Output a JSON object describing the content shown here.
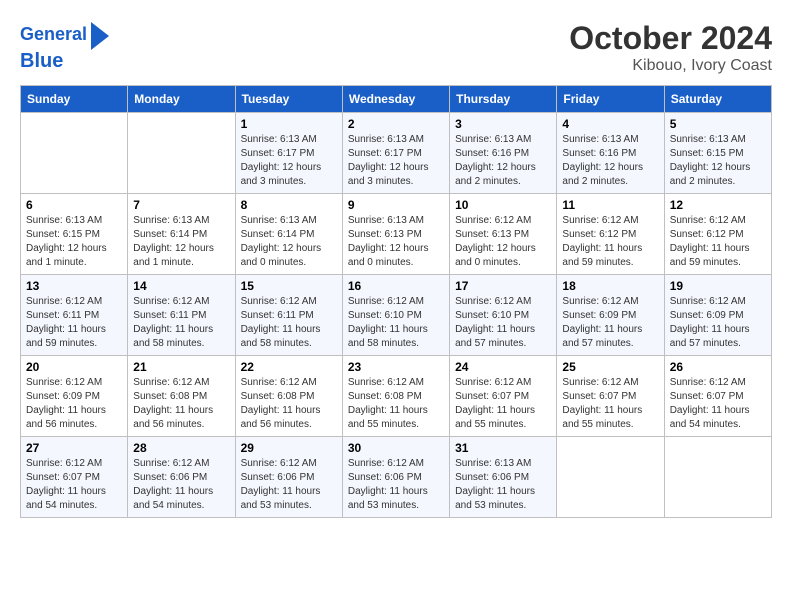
{
  "logo": {
    "line1": "General",
    "line2": "Blue"
  },
  "title": "October 2024",
  "subtitle": "Kibouo, Ivory Coast",
  "days_of_week": [
    "Sunday",
    "Monday",
    "Tuesday",
    "Wednesday",
    "Thursday",
    "Friday",
    "Saturday"
  ],
  "weeks": [
    [
      {
        "day": "",
        "info": ""
      },
      {
        "day": "",
        "info": ""
      },
      {
        "day": "1",
        "info": "Sunrise: 6:13 AM\nSunset: 6:17 PM\nDaylight: 12 hours and 3 minutes."
      },
      {
        "day": "2",
        "info": "Sunrise: 6:13 AM\nSunset: 6:17 PM\nDaylight: 12 hours and 3 minutes."
      },
      {
        "day": "3",
        "info": "Sunrise: 6:13 AM\nSunset: 6:16 PM\nDaylight: 12 hours and 2 minutes."
      },
      {
        "day": "4",
        "info": "Sunrise: 6:13 AM\nSunset: 6:16 PM\nDaylight: 12 hours and 2 minutes."
      },
      {
        "day": "5",
        "info": "Sunrise: 6:13 AM\nSunset: 6:15 PM\nDaylight: 12 hours and 2 minutes."
      }
    ],
    [
      {
        "day": "6",
        "info": "Sunrise: 6:13 AM\nSunset: 6:15 PM\nDaylight: 12 hours and 1 minute."
      },
      {
        "day": "7",
        "info": "Sunrise: 6:13 AM\nSunset: 6:14 PM\nDaylight: 12 hours and 1 minute."
      },
      {
        "day": "8",
        "info": "Sunrise: 6:13 AM\nSunset: 6:14 PM\nDaylight: 12 hours and 0 minutes."
      },
      {
        "day": "9",
        "info": "Sunrise: 6:13 AM\nSunset: 6:13 PM\nDaylight: 12 hours and 0 minutes."
      },
      {
        "day": "10",
        "info": "Sunrise: 6:12 AM\nSunset: 6:13 PM\nDaylight: 12 hours and 0 minutes."
      },
      {
        "day": "11",
        "info": "Sunrise: 6:12 AM\nSunset: 6:12 PM\nDaylight: 11 hours and 59 minutes."
      },
      {
        "day": "12",
        "info": "Sunrise: 6:12 AM\nSunset: 6:12 PM\nDaylight: 11 hours and 59 minutes."
      }
    ],
    [
      {
        "day": "13",
        "info": "Sunrise: 6:12 AM\nSunset: 6:11 PM\nDaylight: 11 hours and 59 minutes."
      },
      {
        "day": "14",
        "info": "Sunrise: 6:12 AM\nSunset: 6:11 PM\nDaylight: 11 hours and 58 minutes."
      },
      {
        "day": "15",
        "info": "Sunrise: 6:12 AM\nSunset: 6:11 PM\nDaylight: 11 hours and 58 minutes."
      },
      {
        "day": "16",
        "info": "Sunrise: 6:12 AM\nSunset: 6:10 PM\nDaylight: 11 hours and 58 minutes."
      },
      {
        "day": "17",
        "info": "Sunrise: 6:12 AM\nSunset: 6:10 PM\nDaylight: 11 hours and 57 minutes."
      },
      {
        "day": "18",
        "info": "Sunrise: 6:12 AM\nSunset: 6:09 PM\nDaylight: 11 hours and 57 minutes."
      },
      {
        "day": "19",
        "info": "Sunrise: 6:12 AM\nSunset: 6:09 PM\nDaylight: 11 hours and 57 minutes."
      }
    ],
    [
      {
        "day": "20",
        "info": "Sunrise: 6:12 AM\nSunset: 6:09 PM\nDaylight: 11 hours and 56 minutes."
      },
      {
        "day": "21",
        "info": "Sunrise: 6:12 AM\nSunset: 6:08 PM\nDaylight: 11 hours and 56 minutes."
      },
      {
        "day": "22",
        "info": "Sunrise: 6:12 AM\nSunset: 6:08 PM\nDaylight: 11 hours and 56 minutes."
      },
      {
        "day": "23",
        "info": "Sunrise: 6:12 AM\nSunset: 6:08 PM\nDaylight: 11 hours and 55 minutes."
      },
      {
        "day": "24",
        "info": "Sunrise: 6:12 AM\nSunset: 6:07 PM\nDaylight: 11 hours and 55 minutes."
      },
      {
        "day": "25",
        "info": "Sunrise: 6:12 AM\nSunset: 6:07 PM\nDaylight: 11 hours and 55 minutes."
      },
      {
        "day": "26",
        "info": "Sunrise: 6:12 AM\nSunset: 6:07 PM\nDaylight: 11 hours and 54 minutes."
      }
    ],
    [
      {
        "day": "27",
        "info": "Sunrise: 6:12 AM\nSunset: 6:07 PM\nDaylight: 11 hours and 54 minutes."
      },
      {
        "day": "28",
        "info": "Sunrise: 6:12 AM\nSunset: 6:06 PM\nDaylight: 11 hours and 54 minutes."
      },
      {
        "day": "29",
        "info": "Sunrise: 6:12 AM\nSunset: 6:06 PM\nDaylight: 11 hours and 53 minutes."
      },
      {
        "day": "30",
        "info": "Sunrise: 6:12 AM\nSunset: 6:06 PM\nDaylight: 11 hours and 53 minutes."
      },
      {
        "day": "31",
        "info": "Sunrise: 6:13 AM\nSunset: 6:06 PM\nDaylight: 11 hours and 53 minutes."
      },
      {
        "day": "",
        "info": ""
      },
      {
        "day": "",
        "info": ""
      }
    ]
  ]
}
